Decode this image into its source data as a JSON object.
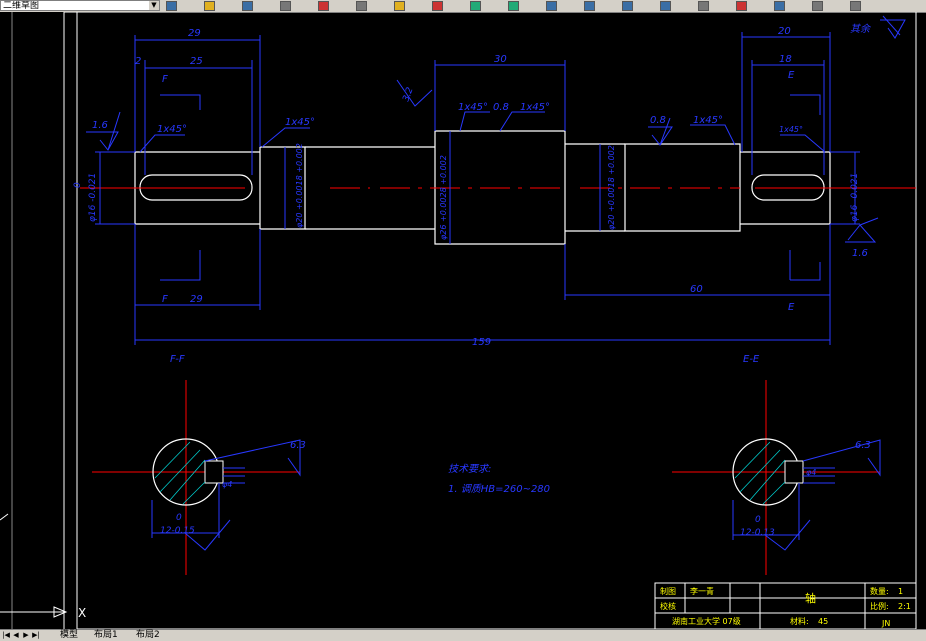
{
  "toolbar": {
    "workspace_value": "二维草图",
    "icons": [
      "layer-icon",
      "open-icon",
      "save-icon",
      "print-icon",
      "cut-icon",
      "copy-icon",
      "paste-icon",
      "brush-icon",
      "undo-icon",
      "redo-icon",
      "pan-icon",
      "zoom-realtime-icon",
      "zoom-window-icon",
      "zoom-previous-icon",
      "properties-icon",
      "design-center-icon",
      "tool-palette-icon",
      "calculator-icon",
      "layer-manager-icon"
    ]
  },
  "tabs": {
    "model": "模型",
    "layout1": "布局1",
    "layout2": "布局2"
  },
  "ucs": {
    "x_label": "X"
  },
  "drawing": {
    "dims": {
      "d29_top": "29",
      "d25": "25",
      "d2": "2",
      "d30": "30",
      "d20_top": "20",
      "d18": "18",
      "d29_bottom": "29",
      "d60": "60",
      "d159": "159",
      "dia_left": "φ16 -0.021",
      "dia_left_zero": "0",
      "dia_bear_left": "φ20 +0.0018 +0.002",
      "dia_center": "φ26 +0.0028 +0.002",
      "dia_bear_right": "φ20 +0.0018 +0.002",
      "dia_right": "φ16 -0.021",
      "dia_right_zero": "0"
    },
    "chamfers": {
      "c1x45_left": "1x45°",
      "c1x45_a": "1x45°",
      "c1x45_b": "1x45°",
      "c1x45_right": "1x45°",
      "c1x45_small": "1x45°",
      "c1x45_bear": "1x45°"
    },
    "roughness": {
      "r16_left": "1.6",
      "r32": "3.2",
      "r08_a": "0.8",
      "r08_b": "0.8",
      "r16_right": "1.6",
      "r63_left": "6.3",
      "r63_right": "6.3",
      "r_all": "其余"
    },
    "sections": {
      "F_top": "F",
      "F_bottom": "F",
      "E_top": "E",
      "E_bottom": "E",
      "F_title": "F-F",
      "E_title": "E-E",
      "f_dim": "12-0.15",
      "f_dim_zero": "0",
      "f_key": "φ4",
      "e_dim": "12-0.13",
      "e_dim_zero": "0",
      "e_key": "φ4 "
    },
    "notes": {
      "title": "技术要求:",
      "line1": "1. 调质HB=260~280"
    },
    "title_block": {
      "drawn": "制图",
      "drawn_name": "李一青",
      "checked": "校核",
      "part_name": "轴",
      "qty_label": "数量:",
      "qty": "1",
      "scale_label": "比例:",
      "scale": "2:1",
      "org": "湖南工业大学 07级",
      "material_label": "材料:",
      "material": "45",
      "sheet": "JN"
    }
  }
}
